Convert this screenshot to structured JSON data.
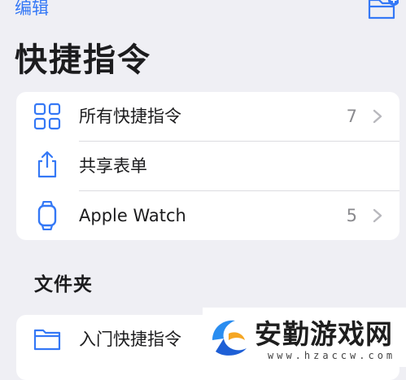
{
  "header": {
    "edit_label": "编辑",
    "title": "快捷指令",
    "new_folder_icon": "folder-badge-plus-icon"
  },
  "shortcut_list": [
    {
      "icon": "grid-icon",
      "label": "所有快捷指令",
      "count": "7"
    },
    {
      "icon": "share-icon",
      "label": "共享表单",
      "count": ""
    },
    {
      "icon": "apple-watch-icon",
      "label": "Apple Watch",
      "count": "5"
    }
  ],
  "folders_section": {
    "title": "文件夹",
    "items": [
      {
        "icon": "folder-icon",
        "label": "入门快捷指令"
      }
    ]
  },
  "watermark": {
    "brand": "安勤游戏网",
    "url": "www.hzaccw.com"
  },
  "colors": {
    "accent": "#3478f6",
    "background": "#efeff4",
    "card": "#ffffff",
    "secondary_text": "#8a8a8e"
  }
}
